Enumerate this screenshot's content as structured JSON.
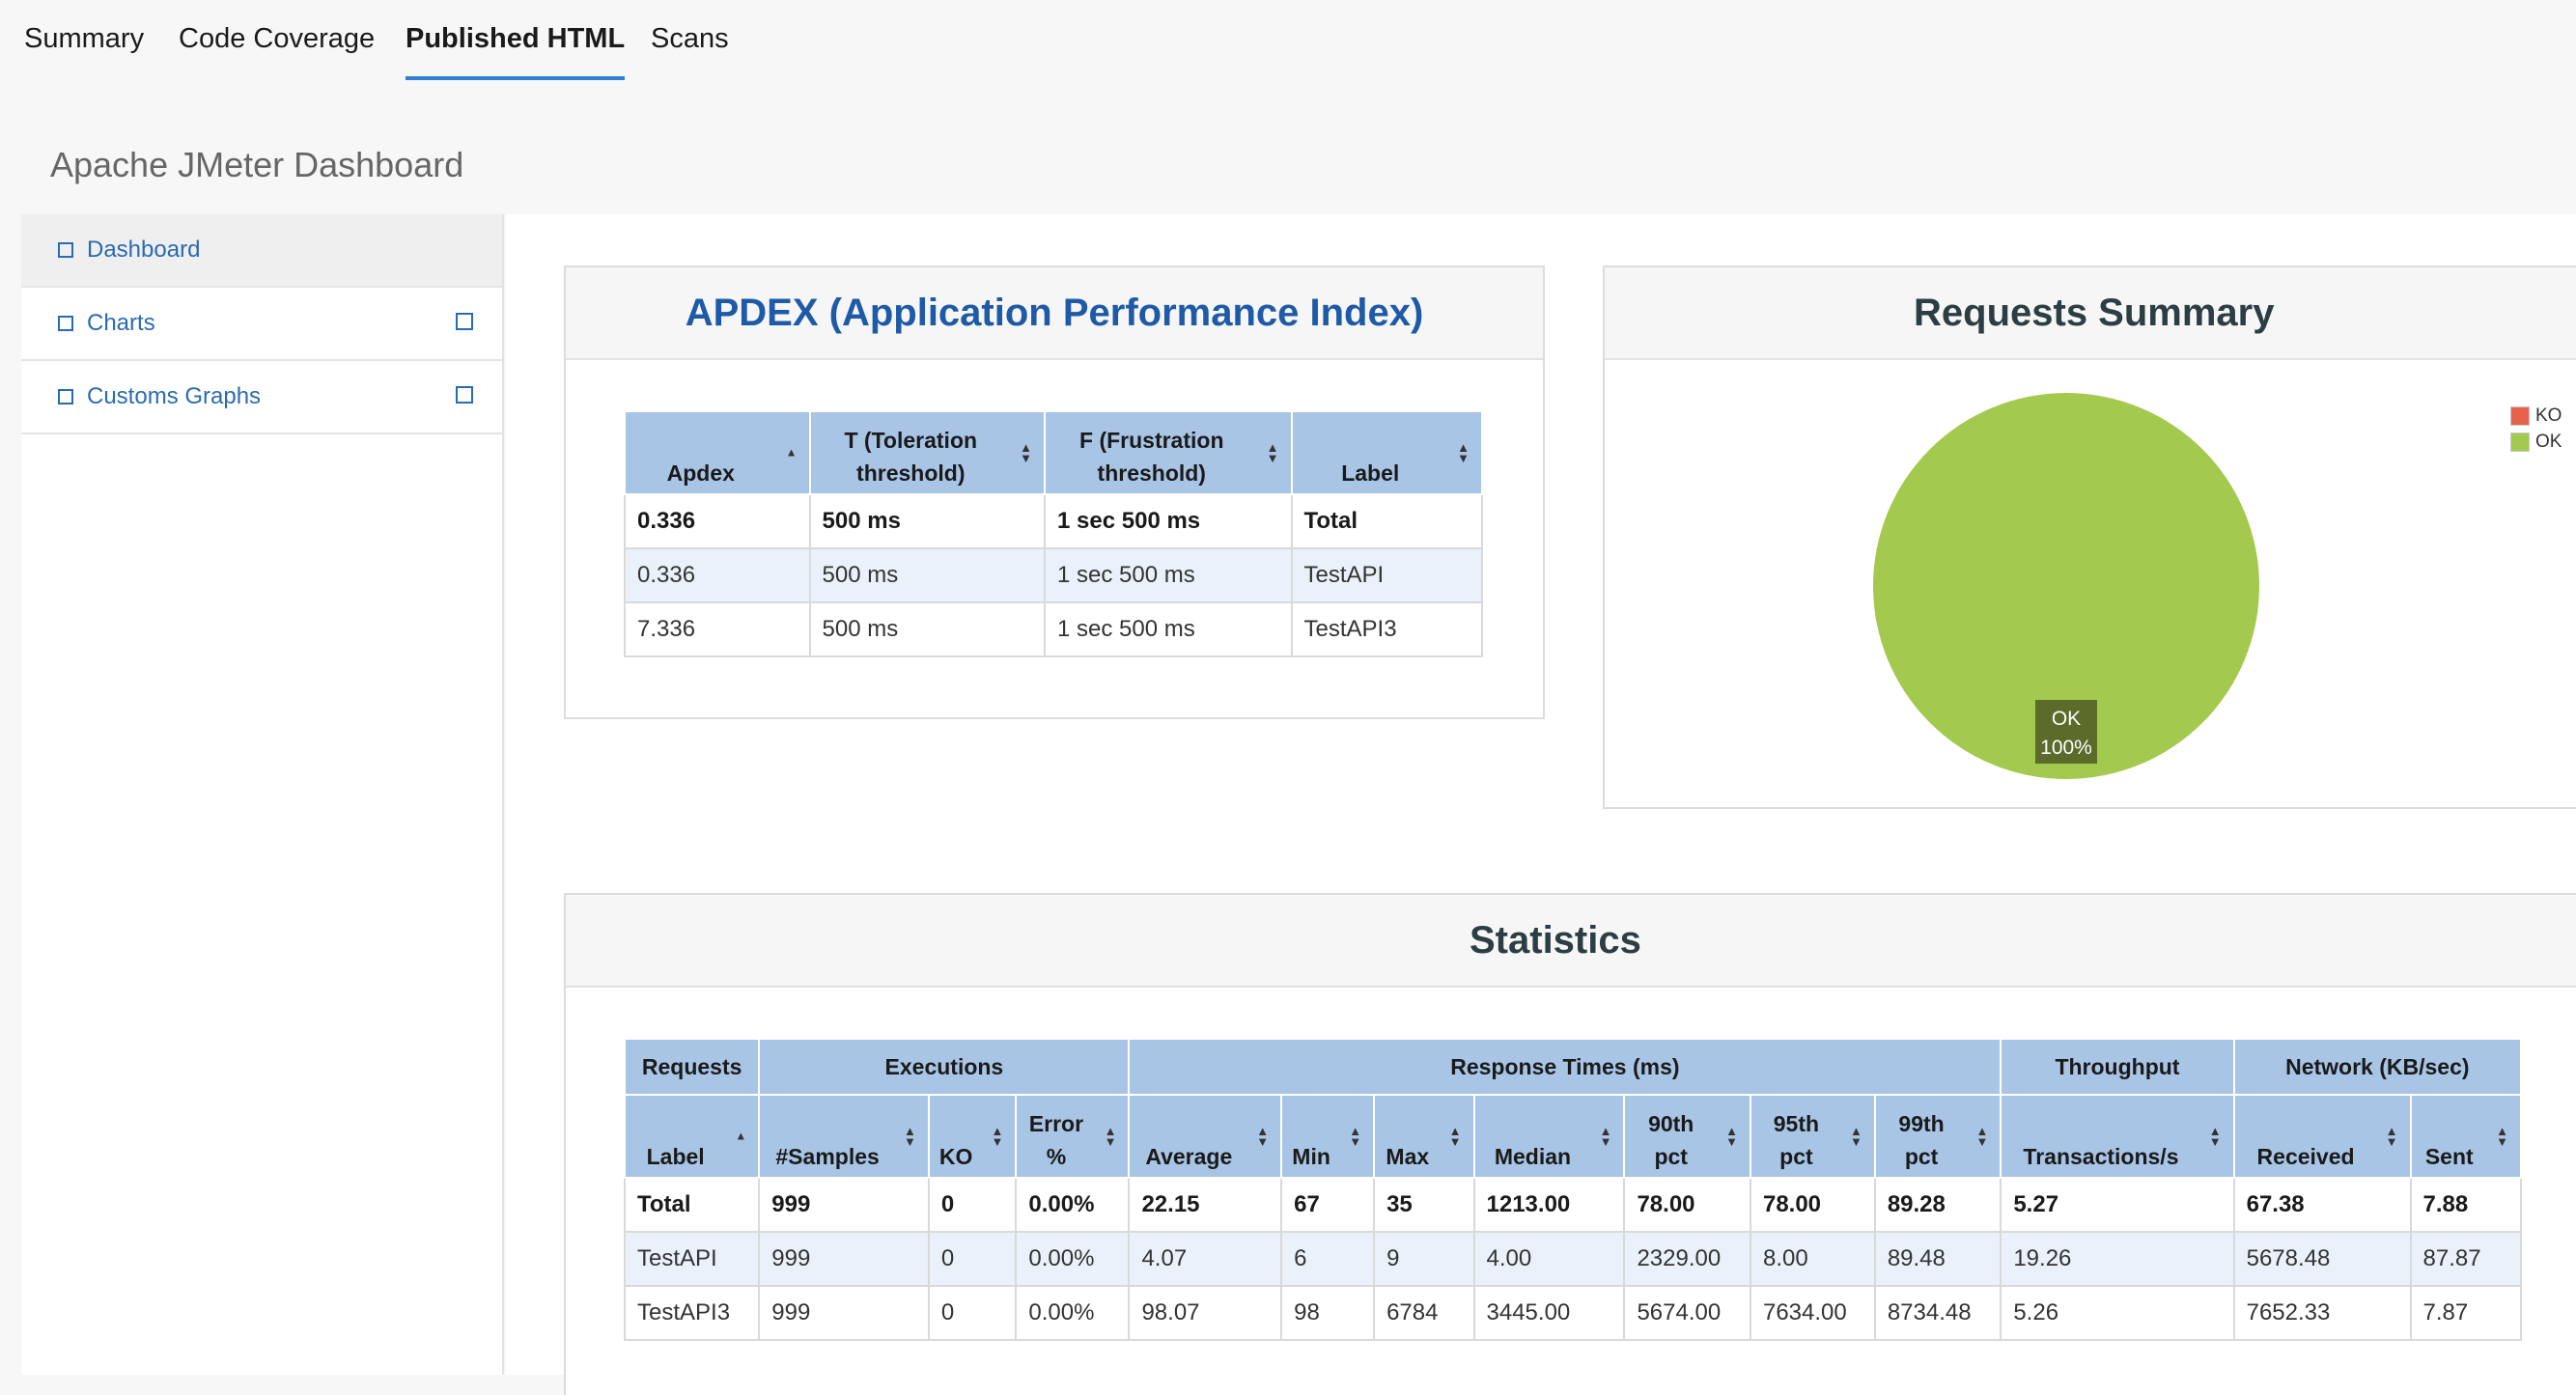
{
  "tabs": [
    {
      "label": "Summary"
    },
    {
      "label": "Code Coverage"
    },
    {
      "label": "Published HTML"
    },
    {
      "label": "Scans"
    }
  ],
  "page_title": "Apache JMeter Dashboard",
  "sidebar": {
    "items": [
      {
        "label": "Dashboard"
      },
      {
        "label": "Charts"
      },
      {
        "label": "Customs Graphs"
      }
    ]
  },
  "apdex": {
    "title": "APDEX (Application Performance Index)",
    "headers": [
      "Apdex",
      "T (Toleration threshold)",
      "F (Frustration threshold)",
      "Label"
    ],
    "header_lines": [
      [
        "Apdex"
      ],
      [
        "T (Toleration",
        "threshold)"
      ],
      [
        "F (Frustration",
        "threshold)"
      ],
      [
        "Label"
      ]
    ],
    "rows": [
      [
        "0.336",
        "500 ms",
        "1 sec 500 ms",
        "Total"
      ],
      [
        "0.336",
        "500 ms",
        "1 sec 500 ms",
        "TestAPI"
      ],
      [
        "7.336",
        "500 ms",
        "1 sec 500 ms",
        "TestAPI3"
      ]
    ]
  },
  "requests_summary": {
    "title": "Requests Summary",
    "legend": [
      {
        "label": "KO",
        "color": "#e8614a"
      },
      {
        "label": "OK",
        "color": "#a3c94e"
      }
    ],
    "pie_label": {
      "line1": "OK",
      "line2": "100%"
    }
  },
  "chart_data": {
    "type": "pie",
    "categories": [
      "KO",
      "OK"
    ],
    "values": [
      0,
      100
    ]
  },
  "statistics": {
    "title": "Statistics",
    "groups": [
      {
        "label": "Requests",
        "span": 1
      },
      {
        "label": "Executions",
        "span": 3
      },
      {
        "label": "Response Times (ms)",
        "span": 7
      },
      {
        "label": "Throughput",
        "span": 1
      },
      {
        "label": "Network (KB/sec)",
        "span": 2
      }
    ],
    "headers": [
      [
        "Label"
      ],
      [
        "#Samples"
      ],
      [
        "KO"
      ],
      [
        "Error",
        "%"
      ],
      [
        "Average"
      ],
      [
        "Min"
      ],
      [
        "Max"
      ],
      [
        "Median"
      ],
      [
        "90th",
        "pct"
      ],
      [
        "95th",
        "pct"
      ],
      [
        "99th",
        "pct"
      ],
      [
        "Transactions/s"
      ],
      [
        "Received"
      ],
      [
        "Sent"
      ]
    ],
    "rows": [
      [
        "Total",
        "999",
        "0",
        "0.00%",
        "22.15",
        "67",
        "35",
        "1213.00",
        "78.00",
        "78.00",
        "89.28",
        "5.27",
        "67.38",
        "7.88"
      ],
      [
        "TestAPI",
        "999",
        "0",
        "0.00%",
        "4.07",
        "6",
        "9",
        "4.00",
        "2329.00",
        "8.00",
        "89.48",
        "19.26",
        "5678.48",
        "87.87"
      ],
      [
        "TestAPI3",
        "999",
        "0",
        "0.00%",
        "98.07",
        "98",
        "6784",
        "3445.00",
        "5674.00",
        "7634.00",
        "8734.48",
        "5.26",
        "7652.33",
        "7.87"
      ]
    ]
  }
}
